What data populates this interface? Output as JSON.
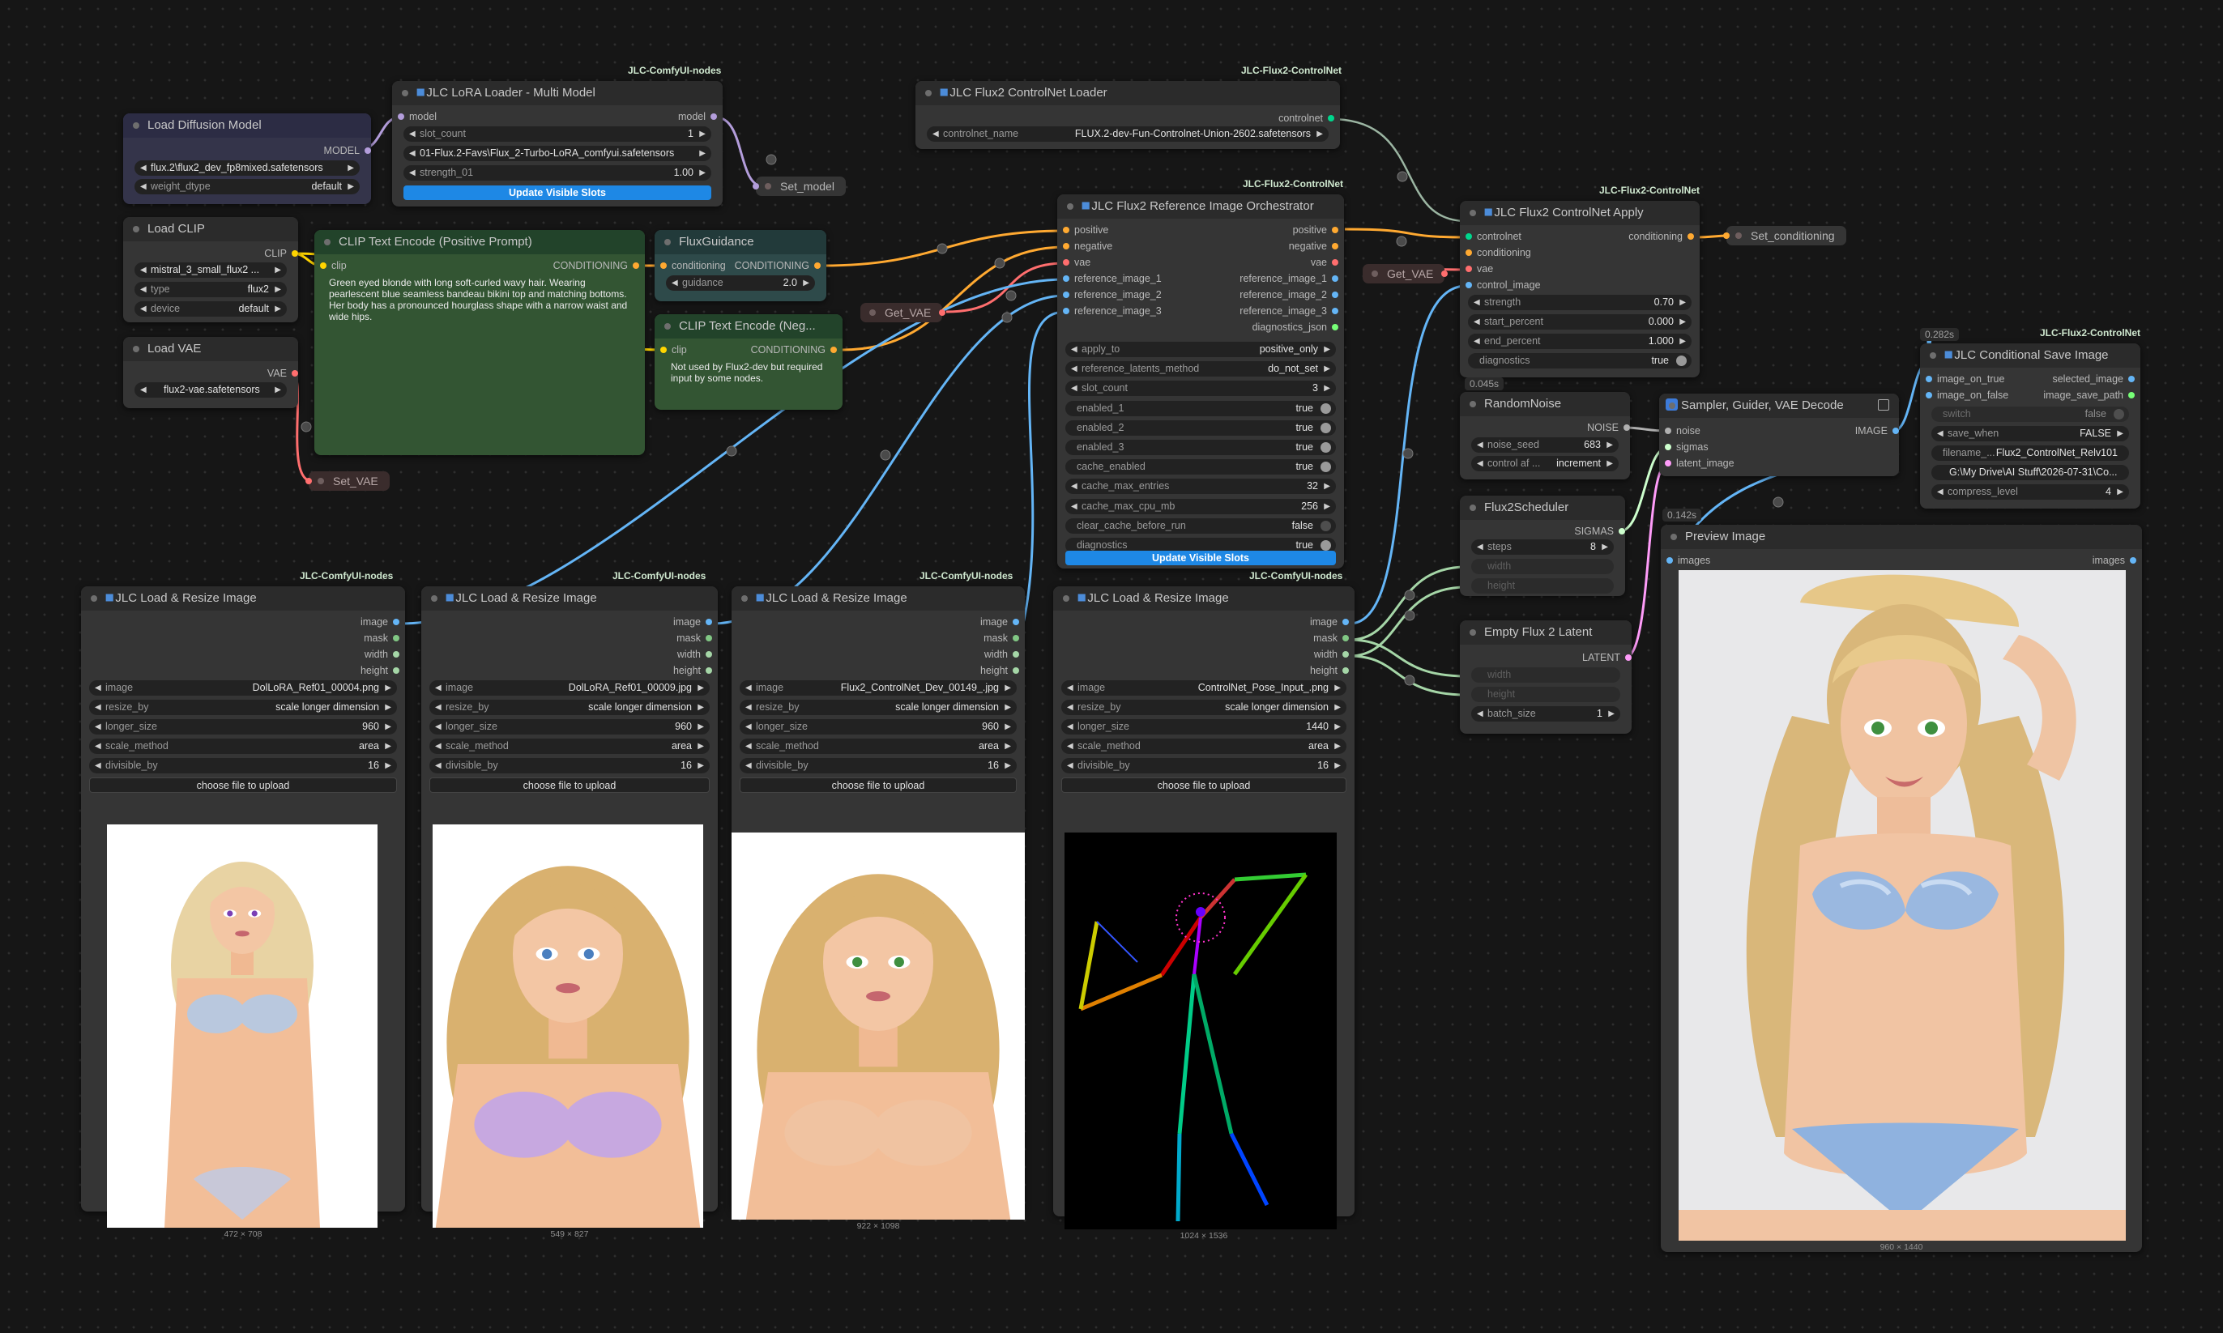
{
  "colors": {
    "model": "#b39ddb",
    "clip": "#ffd500",
    "vae": "#ff6e6e",
    "conditioning": "#ffa931",
    "image": "#64b5f6",
    "mask": "#81c784",
    "int": "#a5d6a7",
    "noise": "#b0b0b0",
    "sigmas": "#cdffcd",
    "latent": "#ff9cf9",
    "controlnet": "#00d78d",
    "string": "#77ff77"
  },
  "nodes": {
    "load_diffusion": {
      "title": "Load Diffusion Model",
      "out_model": "MODEL",
      "unet_value": "flux.2\\flux2_dev_fp8mixed.safetensors",
      "dtype_label": "weight_dtype",
      "dtype_value": "default"
    },
    "lora_loader": {
      "badge": "JLC-ComfyUI-nodes",
      "title": "JLC LoRA Loader - Multi Model",
      "in_model": "model",
      "out_model": "model",
      "slot_count_label": "slot_count",
      "slot_count_value": "1",
      "lora_value": "01-Flux.2-Favs\\Flux_2-Turbo-LoRA_comfyui.safetensors",
      "strength_label": "strength_01",
      "strength_value": "1.00",
      "button": "Update Visible Slots"
    },
    "set_model": {
      "title": "Set_model"
    },
    "load_clip": {
      "title": "Load CLIP",
      "out_clip": "CLIP",
      "clip_value": "mistral_3_small_flux2 ...",
      "type_label": "type",
      "type_value": "flux2",
      "device_label": "device",
      "device_value": "default"
    },
    "clip_pos": {
      "title": "CLIP Text Encode (Positive Prompt)",
      "in_clip": "clip",
      "out": "CONDITIONING",
      "text": "Green eyed blonde with long soft-curled wavy hair. Wearing pearlescent blue seamless bandeau bikini top and matching bottoms. Her body has a pronounced hourglass shape with a narrow waist and wide hips."
    },
    "flux_guidance": {
      "title": "FluxGuidance",
      "in_cond": "conditioning",
      "out": "CONDITIONING",
      "guidance_label": "guidance",
      "guidance_value": "2.0"
    },
    "clip_neg": {
      "title": "CLIP Text Encode (Neg...",
      "in_clip": "clip",
      "out": "CONDITIONING",
      "text": "Not used by Flux2-dev but required input by some nodes."
    },
    "load_vae": {
      "title": "Load VAE",
      "out_vae": "VAE",
      "vae_value": "flux2-vae.safetensors"
    },
    "set_vae": {
      "title": "Set_VAE"
    },
    "get_vae_1": {
      "title": "Get_VAE"
    },
    "get_vae_2": {
      "title": "Get_VAE"
    },
    "cn_loader": {
      "badge": "JLC-Flux2-ControlNet",
      "title": "JLC Flux2 ControlNet Loader",
      "out": "controlnet",
      "name_label": "controlnet_name",
      "name_value": "FLUX.2-dev-Fun-Controlnet-Union-2602.safetensors"
    },
    "orchestrator": {
      "badge": "JLC-Flux2-ControlNet",
      "title": "JLC Flux2 Reference Image Orchestrator",
      "inputs": [
        "positive",
        "negative",
        "vae",
        "reference_image_1",
        "reference_image_2",
        "reference_image_3"
      ],
      "outputs": [
        "positive",
        "negative",
        "vae",
        "reference_image_1",
        "reference_image_2",
        "reference_image_3",
        "diagnostics_json"
      ],
      "widgets": [
        {
          "label": "apply_to",
          "value": "positive_only",
          "kind": "combo"
        },
        {
          "label": "reference_latents_method",
          "value": "do_not_set",
          "kind": "combo"
        },
        {
          "label": "slot_count",
          "value": "3",
          "kind": "combo"
        },
        {
          "label": "enabled_1",
          "value": "true",
          "kind": "toggle"
        },
        {
          "label": "enabled_2",
          "value": "true",
          "kind": "toggle"
        },
        {
          "label": "enabled_3",
          "value": "true",
          "kind": "toggle"
        },
        {
          "label": "cache_enabled",
          "value": "true",
          "kind": "toggle"
        },
        {
          "label": "cache_max_entries",
          "value": "32",
          "kind": "combo"
        },
        {
          "label": "cache_max_cpu_mb",
          "value": "256",
          "kind": "combo"
        },
        {
          "label": "clear_cache_before_run",
          "value": "false",
          "kind": "toggle-off"
        },
        {
          "label": "diagnostics",
          "value": "true",
          "kind": "toggle"
        }
      ],
      "button": "Update Visible Slots"
    },
    "cn_apply": {
      "badge": "JLC-Flux2-ControlNet",
      "title": "JLC Flux2 ControlNet Apply",
      "inputs": [
        "controlnet",
        "conditioning",
        "vae",
        "control_image"
      ],
      "out": "conditioning",
      "widgets": [
        {
          "label": "strength",
          "value": "0.70",
          "kind": "combo"
        },
        {
          "label": "start_percent",
          "value": "0.000",
          "kind": "combo"
        },
        {
          "label": "end_percent",
          "value": "1.000",
          "kind": "combo"
        },
        {
          "label": "diagnostics",
          "value": "true",
          "kind": "toggle"
        }
      ]
    },
    "set_cond": {
      "title": "Set_conditioning"
    },
    "random_noise": {
      "timer": "0.045s",
      "title": "RandomNoise",
      "out": "NOISE",
      "seed_label": "noise_seed",
      "seed_value": "683",
      "control_label": "control af ...",
      "control_value": "increment"
    },
    "scheduler": {
      "title": "Flux2Scheduler",
      "out": "SIGMAS",
      "steps_label": "steps",
      "steps_value": "8",
      "width_label": "width",
      "height_label": "height"
    },
    "empty_latent": {
      "title": "Empty Flux 2 Latent",
      "out": "LATENT",
      "width_label": "width",
      "height_label": "height",
      "batch_label": "batch_size",
      "batch_value": "1"
    },
    "sampler": {
      "title": "Sampler, Guider, VAE Decode",
      "inputs": [
        "noise",
        "sigmas",
        "latent_image"
      ],
      "out": "IMAGE"
    },
    "cond_save": {
      "timer": "0.282s",
      "badge": "JLC-Flux2-ControlNet",
      "title": "JLC Conditional Save Image",
      "in_true": "image_on_true",
      "in_false": "image_on_false",
      "out_selected": "selected_image",
      "out_path": "image_save_path",
      "switch_label": "switch",
      "switch_value": "false",
      "save_when_label": "save_when",
      "save_when_value": "FALSE",
      "filename_label": "filename_...",
      "filename_value": "Flux2_ControlNet_Relv101",
      "path_value": "G:\\My Drive\\AI Stuff\\2026-07-31\\Co...",
      "compress_label": "compress_level",
      "compress_value": "4"
    },
    "preview": {
      "timer": "0.142s",
      "title": "Preview Image",
      "in": "images",
      "out": "images",
      "caption": "960 × 1440"
    },
    "load_resize": [
      {
        "badge": "JLC-ComfyUI-nodes",
        "title": "JLC Load & Resize Image",
        "image": "DolLoRA_Ref01_00004.png",
        "resize_by": "scale longer dimension",
        "longer_size": "960",
        "scale_method": "area",
        "divisible_by": "16",
        "caption": "472 × 708"
      },
      {
        "badge": "JLC-ComfyUI-nodes",
        "title": "JLC Load & Resize Image",
        "image": "DolLoRA_Ref01_00009.jpg",
        "resize_by": "scale longer dimension",
        "longer_size": "960",
        "scale_method": "area",
        "divisible_by": "16",
        "caption": "549 × 827"
      },
      {
        "badge": "JLC-ComfyUI-nodes",
        "title": "JLC Load & Resize Image",
        "image": "Flux2_ControlNet_Dev_00149_.jpg",
        "resize_by": "scale longer dimension",
        "longer_size": "960",
        "scale_method": "area",
        "divisible_by": "16",
        "caption": "922 × 1098"
      },
      {
        "badge": "JLC-ComfyUI-nodes",
        "title": "JLC Load & Resize Image",
        "image": "ControlNet_Pose_Input_.png",
        "resize_by": "scale longer dimension",
        "longer_size": "1440",
        "scale_method": "area",
        "divisible_by": "16",
        "caption": "1024 × 1536"
      }
    ],
    "load_resize_common": {
      "outputs": [
        "image",
        "mask",
        "width",
        "height"
      ],
      "labels": {
        "image": "image",
        "resize_by": "resize_by",
        "longer_size": "longer_size",
        "scale_method": "scale_method",
        "divisible_by": "divisible_by"
      },
      "upload": "choose file to upload"
    }
  }
}
